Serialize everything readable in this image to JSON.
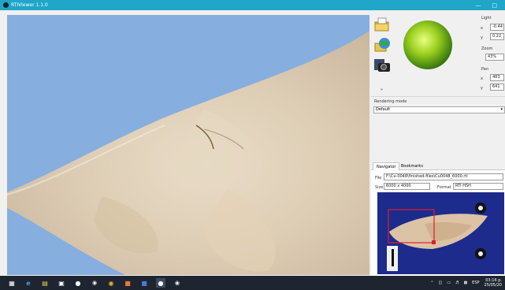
{
  "window": {
    "title": "RTIViewer 1.1.0"
  },
  "light": {
    "label": "Light",
    "x_label": "x",
    "x_value": "-0.44",
    "y_label": "y",
    "y_value": "0.22"
  },
  "zoom": {
    "label": "Zoom",
    "value": "43%"
  },
  "pan": {
    "label": "Pan",
    "x_label": "x",
    "x_value": "483",
    "y_label": "y",
    "y_value": "641"
  },
  "rendering": {
    "label": "Rendering mode",
    "selected": "Default"
  },
  "tabs": [
    "Navigator",
    "Bookmarks"
  ],
  "navigator": {
    "file_label": "File",
    "file_value": "F:\\Cu-0048\\finished-files\\Cu0048_6000.rti",
    "size_label": "Size",
    "size_value": "6000 x 4000",
    "format_label": "Format",
    "format_value": "RTI HSH"
  },
  "toolbar": {
    "expand_label": "»"
  },
  "tray": {
    "lang": "ESP",
    "time": "03:16 p.",
    "date": "25/05/20"
  },
  "colors": {
    "titlebar": "#1fa6c9",
    "taskbar": "#1e2530",
    "viewport_bg": "#86aedf",
    "roi": "#e0202a",
    "thumb_bg": "#1c2b8c"
  }
}
